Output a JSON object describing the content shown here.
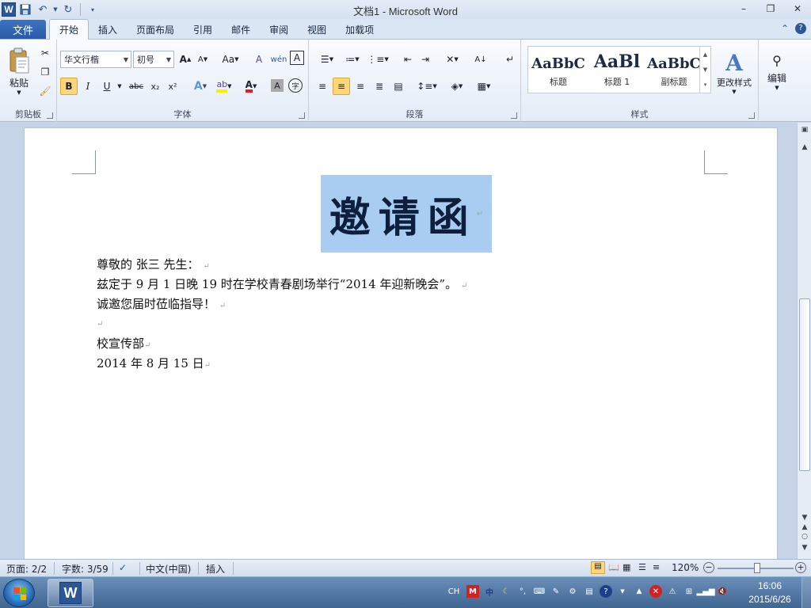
{
  "window": {
    "title": "文档1 - Microsoft Word",
    "app_logo": "W",
    "minimize_icon": "–",
    "restore_icon": "❐",
    "close_icon": "✕"
  },
  "ribbon": {
    "file_tab": "文件",
    "tabs": [
      "开始",
      "插入",
      "页面布局",
      "引用",
      "邮件",
      "审阅",
      "视图",
      "加载项"
    ],
    "active_tab": "开始",
    "clipboard": {
      "label": "剪贴板",
      "paste": "粘贴"
    },
    "font": {
      "label": "字体",
      "font_name": "华文行楷",
      "font_size": "初号",
      "bold": "B",
      "italic": "I",
      "underline": "U",
      "strike": "abc",
      "subscript": "x₂",
      "superscript": "x²",
      "grow": "A",
      "shrink": "A",
      "change_case": "Aa",
      "clear": "A",
      "pinyin": "wén",
      "char_border": "A",
      "text_effect": "A",
      "font_color": "A",
      "char_shade": "A",
      "enclose": "字"
    },
    "paragraph": {
      "label": "段落"
    },
    "styles": {
      "label": "样式",
      "items": [
        {
          "sample": "AaBbC",
          "name": "标题"
        },
        {
          "sample": "AaBl",
          "name": "标题 1"
        },
        {
          "sample": "AaBbC",
          "name": "副标题"
        }
      ],
      "change_styles": "更改样式"
    },
    "editing": {
      "label": "编辑"
    },
    "accent_color": "#2b5797"
  },
  "document": {
    "title": "邀请函",
    "lines": [
      "尊敬的  张三  先生：",
      "兹定于 9 月 1 日晚 19 时在学校青春剧场举行“2014 年迎新晚会”。",
      "诚邀您届时莅临指导！",
      "",
      "校宣传部",
      "2014 年 8 月 15 日"
    ],
    "paragraph_mark": "↵",
    "title_highlight": "#a8cdf0"
  },
  "statusbar": {
    "page": "页面: 2/2",
    "words": "字数: 3/59",
    "language": "中文(中国)",
    "mode": "插入",
    "zoom": "120%"
  },
  "taskbar": {
    "tray_lang": "CH",
    "time": "16:06",
    "date": "2015/6/26"
  }
}
